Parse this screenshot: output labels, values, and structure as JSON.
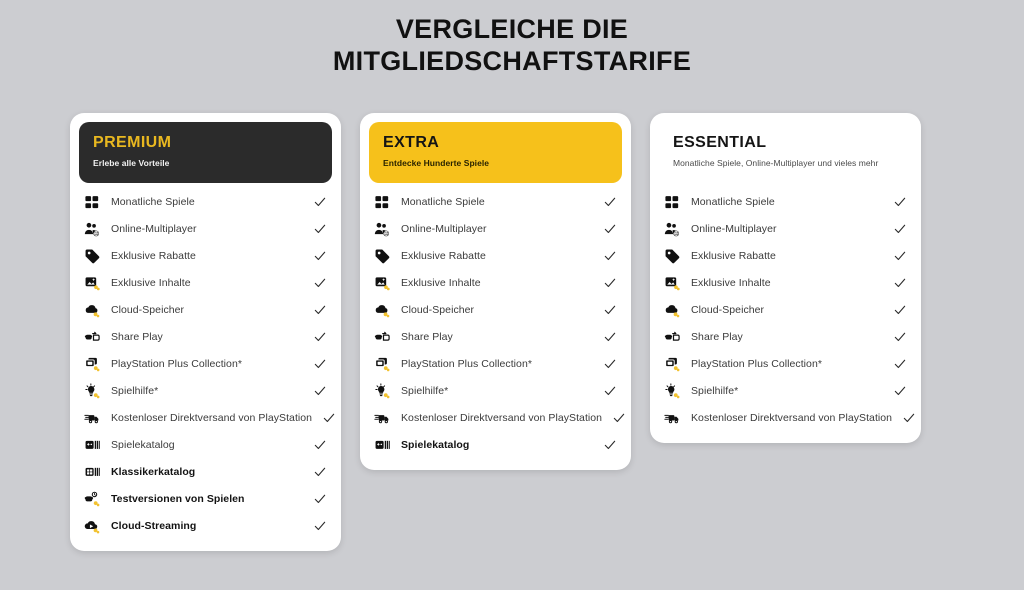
{
  "heading": {
    "line1": "VERGLEICHE DIE",
    "line2": "MITGLIEDSCHAFTSTARIFE"
  },
  "colors": {
    "page_background": "#cccdd1",
    "card_background": "#ffffff",
    "premium_header_bg": "#2b2b2b",
    "premium_title": "#e9b820",
    "extra_header_bg": "#f6c11b",
    "extra_title": "#151515",
    "essential_header_bg": "#ffffff",
    "essential_title": "#151515",
    "label_text": "#3b3b3b",
    "check_mark": "#2c2c2c",
    "icon_accent": "#f2c230"
  },
  "cards": [
    {
      "id": "premium",
      "tier": "PREMIUM",
      "subtitle": "Erlebe alle Vorteile",
      "features": [
        {
          "label": "Monatliche Spiele",
          "icon": "monthly-games-icon",
          "included": true,
          "checkmark": "✓",
          "bold": false
        },
        {
          "label": "Online-Multiplayer",
          "icon": "online-multiplayer-icon",
          "included": true,
          "checkmark": "✓",
          "bold": false
        },
        {
          "label": "Exklusive Rabatte",
          "icon": "exclusive-discounts-icon",
          "included": true,
          "checkmark": "✓",
          "bold": false
        },
        {
          "label": "Exklusive Inhalte",
          "icon": "exclusive-content-icon",
          "included": true,
          "checkmark": "✓",
          "bold": false
        },
        {
          "label": "Cloud-Speicher",
          "icon": "cloud-storage-icon",
          "included": true,
          "checkmark": "✓",
          "bold": false
        },
        {
          "label": "Share Play",
          "icon": "share-play-icon",
          "included": true,
          "checkmark": "✓",
          "bold": false
        },
        {
          "label": "PlayStation Plus Collection*",
          "icon": "plus-collection-icon",
          "included": true,
          "checkmark": "✓",
          "bold": false
        },
        {
          "label": "Spielhilfe*",
          "icon": "game-help-icon",
          "included": true,
          "checkmark": "✓",
          "bold": false
        },
        {
          "label": "Kostenloser Direktversand von PlayStation",
          "icon": "free-shipping-icon",
          "included": true,
          "checkmark": "✓",
          "bold": false
        },
        {
          "label": "Spielekatalog",
          "icon": "game-catalog-icon",
          "included": true,
          "checkmark": "✓",
          "bold": false
        },
        {
          "label": "Klassikerkatalog",
          "icon": "classics-catalog-icon",
          "included": true,
          "checkmark": "✓",
          "bold": true
        },
        {
          "label": "Testversionen von Spielen",
          "icon": "game-trials-icon",
          "included": true,
          "checkmark": "✓",
          "bold": true
        },
        {
          "label": "Cloud-Streaming",
          "icon": "cloud-streaming-icon",
          "included": true,
          "checkmark": "✓",
          "bold": true
        }
      ]
    },
    {
      "id": "extra",
      "tier": "EXTRA",
      "subtitle": "Entdecke Hunderte Spiele",
      "features": [
        {
          "label": "Monatliche Spiele",
          "icon": "monthly-games-icon",
          "included": true,
          "checkmark": "✓",
          "bold": false
        },
        {
          "label": "Online-Multiplayer",
          "icon": "online-multiplayer-icon",
          "included": true,
          "checkmark": "✓",
          "bold": false
        },
        {
          "label": "Exklusive Rabatte",
          "icon": "exclusive-discounts-icon",
          "included": true,
          "checkmark": "✓",
          "bold": false
        },
        {
          "label": "Exklusive Inhalte",
          "icon": "exclusive-content-icon",
          "included": true,
          "checkmark": "✓",
          "bold": false
        },
        {
          "label": "Cloud-Speicher",
          "icon": "cloud-storage-icon",
          "included": true,
          "checkmark": "✓",
          "bold": false
        },
        {
          "label": "Share Play",
          "icon": "share-play-icon",
          "included": true,
          "checkmark": "✓",
          "bold": false
        },
        {
          "label": "PlayStation Plus Collection*",
          "icon": "plus-collection-icon",
          "included": true,
          "checkmark": "✓",
          "bold": false
        },
        {
          "label": "Spielhilfe*",
          "icon": "game-help-icon",
          "included": true,
          "checkmark": "✓",
          "bold": false
        },
        {
          "label": "Kostenloser Direktversand von PlayStation",
          "icon": "free-shipping-icon",
          "included": true,
          "checkmark": "✓",
          "bold": false
        },
        {
          "label": "Spielekatalog",
          "icon": "game-catalog-icon",
          "included": true,
          "checkmark": "✓",
          "bold": true
        }
      ]
    },
    {
      "id": "essential",
      "tier": "ESSENTIAL",
      "subtitle": "Monatliche Spiele, Online-Multiplayer und vieles mehr",
      "features": [
        {
          "label": "Monatliche Spiele",
          "icon": "monthly-games-icon",
          "included": true,
          "checkmark": "✓",
          "bold": false
        },
        {
          "label": "Online-Multiplayer",
          "icon": "online-multiplayer-icon",
          "included": true,
          "checkmark": "✓",
          "bold": false
        },
        {
          "label": "Exklusive Rabatte",
          "icon": "exclusive-discounts-icon",
          "included": true,
          "checkmark": "✓",
          "bold": false
        },
        {
          "label": "Exklusive Inhalte",
          "icon": "exclusive-content-icon",
          "included": true,
          "checkmark": "✓",
          "bold": false
        },
        {
          "label": "Cloud-Speicher",
          "icon": "cloud-storage-icon",
          "included": true,
          "checkmark": "✓",
          "bold": false
        },
        {
          "label": "Share Play",
          "icon": "share-play-icon",
          "included": true,
          "checkmark": "✓",
          "bold": false
        },
        {
          "label": "PlayStation Plus Collection*",
          "icon": "plus-collection-icon",
          "included": true,
          "checkmark": "✓",
          "bold": false
        },
        {
          "label": "Spielhilfe*",
          "icon": "game-help-icon",
          "included": true,
          "checkmark": "✓",
          "bold": false
        },
        {
          "label": "Kostenloser Direktversand von PlayStation",
          "icon": "free-shipping-icon",
          "included": true,
          "checkmark": "✓",
          "bold": false
        }
      ]
    }
  ]
}
